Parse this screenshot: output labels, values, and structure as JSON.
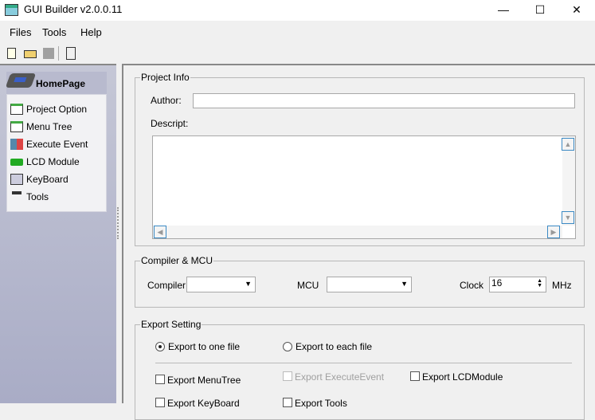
{
  "window": {
    "title": "GUI Builder v2.0.0.11",
    "minimize": "—",
    "maximize": "☐",
    "close": "✕"
  },
  "menu": {
    "files": "Files",
    "tools": "Tools",
    "help": "Help"
  },
  "toolbar": {
    "icons": [
      "new-file-icon",
      "open-folder-icon",
      "save-icon",
      "exit-icon"
    ]
  },
  "sidebar": {
    "header": "HomePage",
    "items": [
      {
        "label": "Project Option",
        "icon": "project-option-icon"
      },
      {
        "label": "Menu Tree",
        "icon": "menu-tree-icon"
      },
      {
        "label": "Execute Event",
        "icon": "execute-event-icon"
      },
      {
        "label": "LCD Module",
        "icon": "lcd-module-icon"
      },
      {
        "label": "KeyBoard",
        "icon": "keyboard-icon"
      },
      {
        "label": "Tools",
        "icon": "tools-icon"
      }
    ]
  },
  "project_info": {
    "title": "Project Info",
    "author_label": "Author:",
    "author_value": "",
    "descript_label": "Descript:",
    "descript_value": ""
  },
  "compiler": {
    "title": "Compiler & MCU",
    "compiler_label": "Compiler",
    "compiler_value": "",
    "mcu_label": "MCU",
    "mcu_value": "",
    "clock_label": "Clock",
    "clock_value": "16",
    "clock_unit": "MHz"
  },
  "export": {
    "title": "Export Setting",
    "radio_one": "Export to one file",
    "radio_each": "Export to each file",
    "menutree": "Export MenuTree",
    "executeevent": "Export ExecuteEvent",
    "lcdmodule": "Export LCDModule",
    "keyboard": "Export KeyBoard",
    "tools": "Export Tools"
  }
}
